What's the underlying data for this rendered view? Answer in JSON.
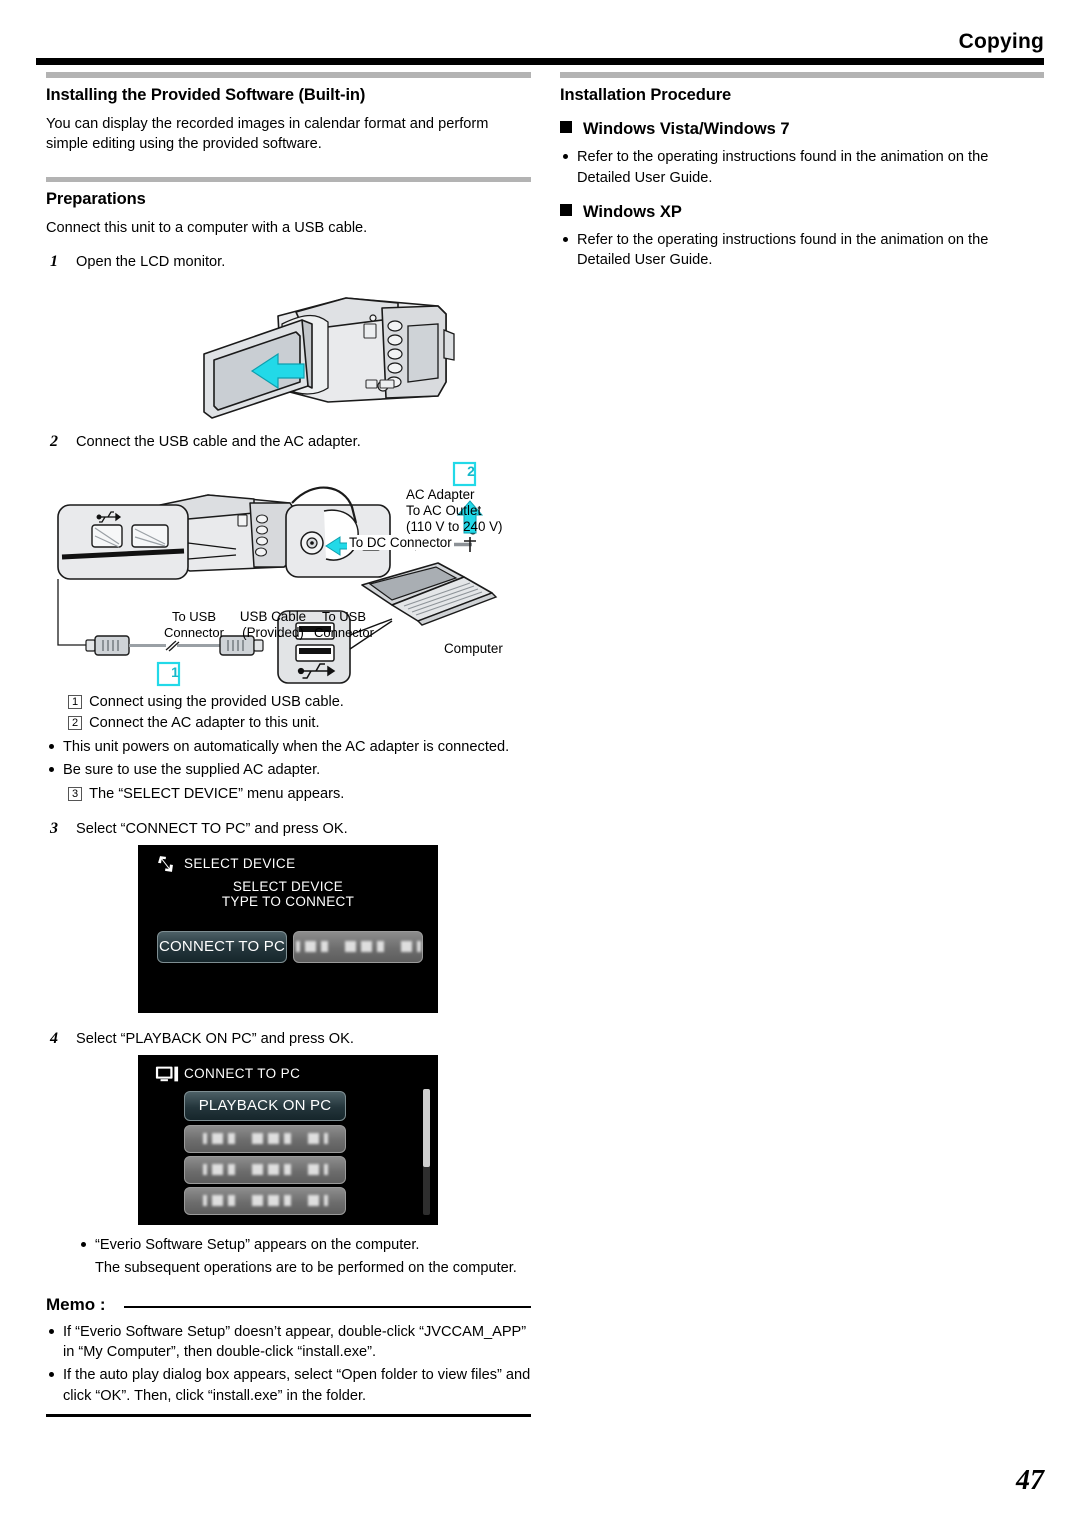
{
  "header": {
    "title": "Copying"
  },
  "page_number": "47",
  "left": {
    "section_title": "Installing the Provided Software (Built-in)",
    "intro": "You can display the recorded images in calendar format and perform simple editing using the provided software.",
    "preparations_title": "Preparations",
    "preparations_intro": "Connect this unit to a computer with a USB cable.",
    "steps": [
      {
        "num": "1",
        "text": "Open the LCD monitor."
      },
      {
        "num": "2",
        "text": "Connect the USB cable and the AC adapter."
      },
      {
        "num": "3",
        "text": "Select “CONNECT TO PC” and press OK."
      },
      {
        "num": "4",
        "text": "Select “PLAYBACK ON PC” and press OK."
      }
    ],
    "diagram_labels": {
      "badge_2": "2",
      "badge_1": "1",
      "ac_adapter": "AC Adapter",
      "to_ac_outlet": "To AC Outlet",
      "voltage": "(110 V to 240 V)",
      "to_dc_connector": "To DC Connector",
      "to_usb_connector_left_1": "To USB",
      "to_usb_connector_left_2": "Connector",
      "usb_cable_1": "USB Cable",
      "usb_cable_2": "(Provided)",
      "to_usb_connector_right_1": "To USB",
      "to_usb_connector_right_2": "Connector",
      "computer": "Computer"
    },
    "callouts": [
      {
        "num": "1",
        "text": "Connect using the provided USB cable."
      },
      {
        "num": "2",
        "text": "Connect the AC adapter to this unit."
      }
    ],
    "notes_after_callouts": [
      "This unit powers on automatically when the AC adapter is connected.",
      "Be sure to use the supplied AC adapter."
    ],
    "callout_3": {
      "num": "3",
      "text": "The “SELECT DEVICE” menu appears."
    },
    "lcd_select_device": {
      "icon": "usb-transfer-icon",
      "title": "SELECT DEVICE",
      "subtitle_line1": "SELECT DEVICE",
      "subtitle_line2": "TYPE TO CONNECT",
      "button_selected": "CONNECT TO PC",
      "button_other": ""
    },
    "lcd_connect_to_pc": {
      "icon": "monitor-icon",
      "title": "CONNECT TO PC",
      "button_selected": "PLAYBACK ON PC",
      "buttons_other": [
        "",
        "",
        ""
      ]
    },
    "after_step4_notes": [
      "“Everio Software Setup” appears on the computer.",
      "The subsequent operations are to be performed on the computer."
    ],
    "memo": {
      "label": "Memo :",
      "items": [
        "If “Everio Software Setup” doesn’t appear, double-click “JVCCAM_APP” in “My Computer”, then double-click “install.exe”.",
        "If the auto play dialog box appears, select “Open folder to view files” and click “OK”. Then, click “install.exe” in the folder."
      ]
    }
  },
  "right": {
    "section_title": "Installation Procedure",
    "groups": [
      {
        "heading": "Windows Vista/Windows 7",
        "bullet": "Refer to the operating instructions found in the animation on the Detailed User Guide."
      },
      {
        "heading": "Windows XP",
        "bullet": "Refer to the operating instructions found in the animation on the Detailed User Guide."
      }
    ]
  },
  "colors": {
    "accent_cyan": "#00e5f5",
    "rule_black": "#000000",
    "section_bar_gray": "#b3b3b3",
    "lcd_background": "#000000"
  }
}
